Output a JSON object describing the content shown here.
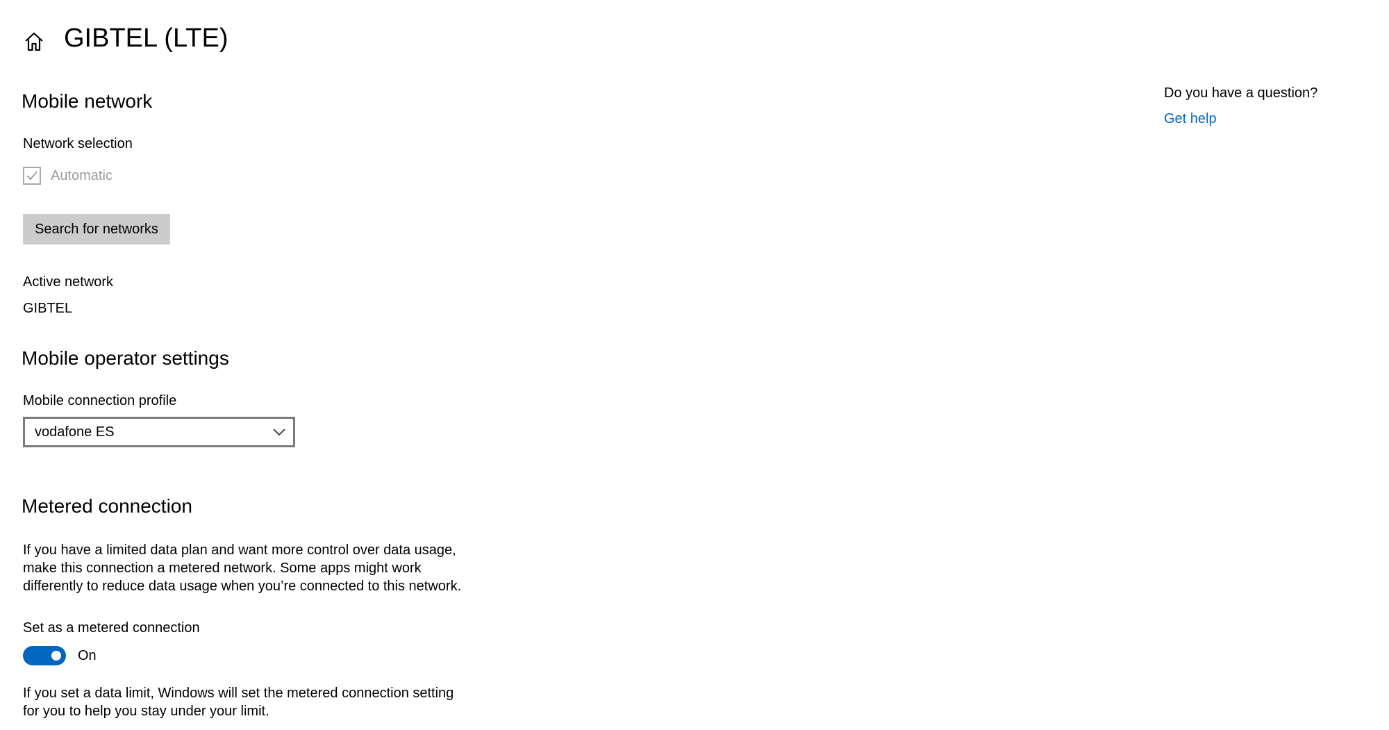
{
  "header": {
    "title": "GIBTEL (LTE)",
    "home_icon": "home-icon"
  },
  "mobile_network": {
    "heading": "Mobile network",
    "network_selection_label": "Network selection",
    "automatic_label": "Automatic",
    "automatic_checked": true,
    "search_button_label": "Search for networks",
    "active_network_label": "Active network",
    "active_network_value": "GIBTEL"
  },
  "operator_settings": {
    "heading": "Mobile operator settings",
    "profile_label": "Mobile connection profile",
    "profile_selected": "vodafone ES"
  },
  "metered": {
    "heading": "Metered connection",
    "description_line1": "If you have a limited data plan and want more control over data usage,",
    "description_line2": "make this connection a metered network. Some apps might work",
    "description_line3": "differently to reduce data usage when you’re connected to this network.",
    "toggle_label": "Set as a metered connection",
    "toggle_state": "On",
    "toggle_on": true,
    "note_line1": "If you set a data limit, Windows will set the metered connection setting",
    "note_line2": "for you to help you stay under your limit."
  },
  "help": {
    "question": "Do you have a question?",
    "link_label": "Get help"
  },
  "colors": {
    "accent": "#0067c0",
    "button_bg": "#cccccc",
    "disabled_text": "#9b9b9b"
  }
}
